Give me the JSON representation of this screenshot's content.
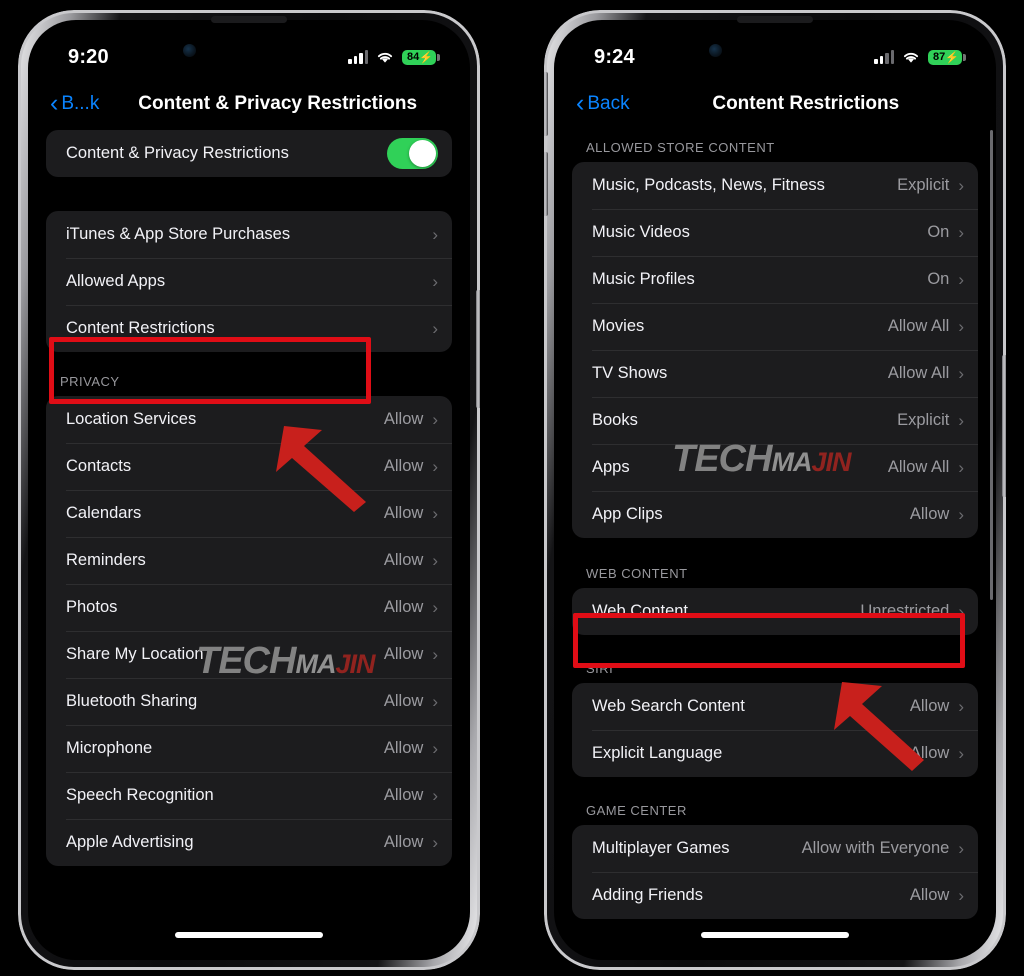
{
  "left_phone": {
    "status": {
      "time": "9:20",
      "battery_level": "84",
      "battery_charging_icon": "bolt-icon",
      "signal_icon": "cellular-signal-icon",
      "wifi_icon": "wifi-icon"
    },
    "nav": {
      "back_label": "B...k",
      "back_icon": "chevron-left-icon",
      "title": "Content & Privacy Restrictions"
    },
    "toggle_row": {
      "label": "Content & Privacy Restrictions",
      "state": "on"
    },
    "menu_group": [
      {
        "label": "iTunes & App Store Purchases",
        "value": "",
        "chevron": "chevron-right-icon"
      },
      {
        "label": "Allowed Apps",
        "value": "",
        "chevron": "chevron-right-icon"
      },
      {
        "label": "Content Restrictions",
        "value": "",
        "chevron": "chevron-right-icon",
        "highlighted": true
      }
    ],
    "privacy_header": "PRIVACY",
    "privacy_group": [
      {
        "label": "Location Services",
        "value": "Allow"
      },
      {
        "label": "Contacts",
        "value": "Allow"
      },
      {
        "label": "Calendars",
        "value": "Allow"
      },
      {
        "label": "Reminders",
        "value": "Allow"
      },
      {
        "label": "Photos",
        "value": "Allow"
      },
      {
        "label": "Share My Location",
        "value": "Allow"
      },
      {
        "label": "Bluetooth Sharing",
        "value": "Allow"
      },
      {
        "label": "Microphone",
        "value": "Allow"
      },
      {
        "label": "Speech Recognition",
        "value": "Allow"
      },
      {
        "label": "Apple Advertising",
        "value": "Allow"
      }
    ]
  },
  "right_phone": {
    "status": {
      "time": "9:24",
      "battery_level": "87",
      "battery_charging_icon": "bolt-icon",
      "signal_icon": "cellular-signal-icon",
      "wifi_icon": "wifi-icon"
    },
    "nav": {
      "back_label": "Back",
      "back_icon": "chevron-left-icon",
      "title": "Content Restrictions"
    },
    "store_header": "ALLOWED STORE CONTENT",
    "store_group": [
      {
        "label": "Music, Podcasts, News, Fitness",
        "value": "Explicit"
      },
      {
        "label": "Music Videos",
        "value": "On"
      },
      {
        "label": "Music Profiles",
        "value": "On"
      },
      {
        "label": "Movies",
        "value": "Allow All"
      },
      {
        "label": "TV Shows",
        "value": "Allow All"
      },
      {
        "label": "Books",
        "value": "Explicit"
      },
      {
        "label": "Apps",
        "value": "Allow All"
      },
      {
        "label": "App Clips",
        "value": "Allow"
      }
    ],
    "web_header": "WEB CONTENT",
    "web_group": [
      {
        "label": "Web Content",
        "value": "Unrestricted",
        "highlighted": true
      }
    ],
    "siri_header": "SIRI",
    "siri_group": [
      {
        "label": "Web Search Content",
        "value": "Allow"
      },
      {
        "label": "Explicit Language",
        "value": "Allow"
      }
    ],
    "gamecenter_header": "GAME CENTER",
    "gamecenter_group": [
      {
        "label": "Multiplayer Games",
        "value": "Allow with Everyone"
      },
      {
        "label": "Adding Friends",
        "value": "Allow"
      }
    ]
  },
  "watermark": {
    "part1": "TECH",
    "part2": "MA",
    "part3": "JIN"
  },
  "annotations": {
    "left_highlight_target": "Content Restrictions",
    "right_highlight_target": "Web Content",
    "arrow_icon": "arrow-up-left-icon",
    "accent_color": "#e00d16"
  }
}
